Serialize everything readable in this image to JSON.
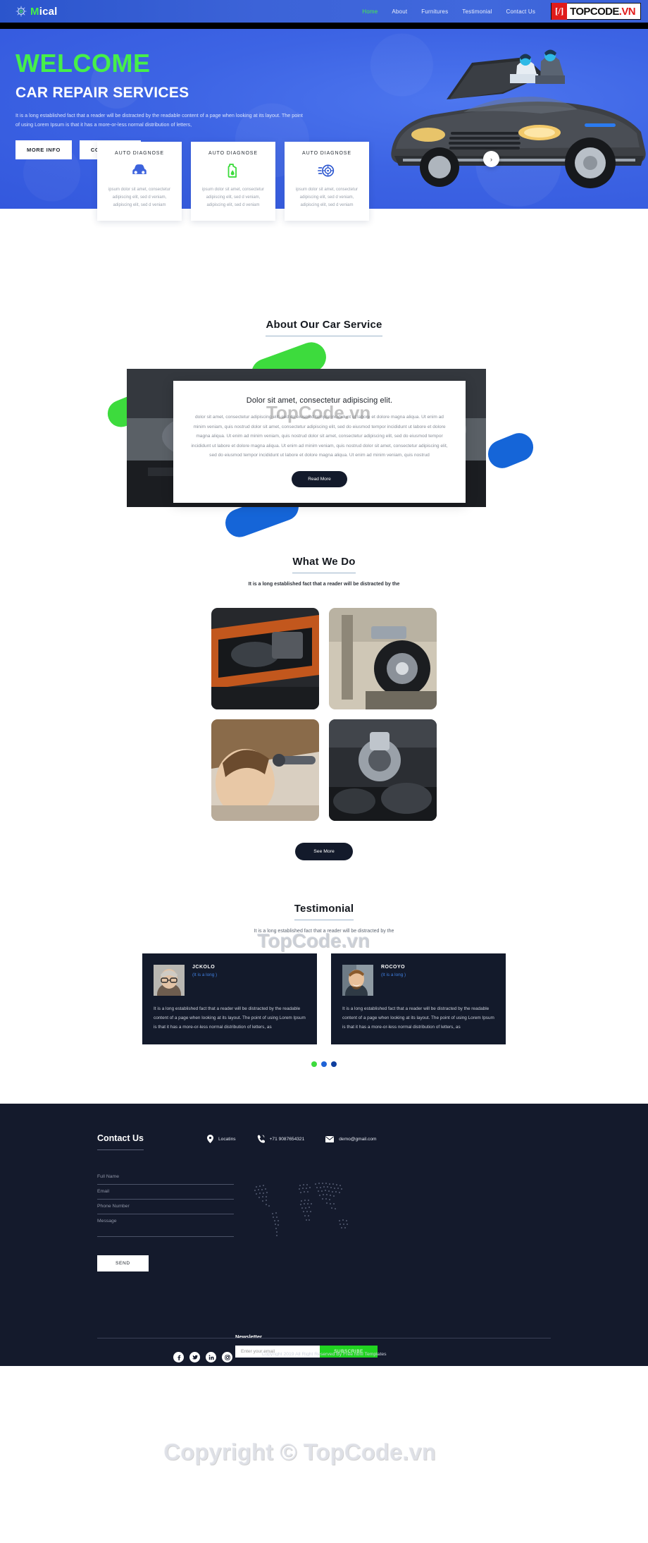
{
  "header": {
    "logo_text_green": "M",
    "logo_text_white": "ical",
    "logo_icon": "gear-logo-icon",
    "nav": [
      {
        "label": "Home",
        "active": true
      },
      {
        "label": "About",
        "active": false
      },
      {
        "label": "Furnitures",
        "active": false
      },
      {
        "label": "Testimonial",
        "active": false
      },
      {
        "label": "Contact Us",
        "active": false
      }
    ],
    "badge": {
      "mark": "[/]",
      "word_black": "TOPCODE",
      "word_red": ".VN"
    }
  },
  "hero": {
    "eyebrow": "WELCOME",
    "title": "CAR REPAIR SERVICES",
    "description": "It is a long established fact that a reader will be distracted by the readable content of a page when looking at its layout. The point of using Lorem Ipsum is that it has a more-or-less normal distribution of letters,",
    "buttons": [
      {
        "label": "MORE INFO"
      },
      {
        "label": "CONTACT US"
      }
    ],
    "next_arrow": "›"
  },
  "service_cards": [
    {
      "title": "AUTO DIAGNOSE",
      "icon": "car-icon",
      "icon_color": "#3d63dd",
      "description": "ipsum dolor sit amet, consectetur adipiscing elit, sed d veniam, adipiscing elit, sed d veniam"
    },
    {
      "title": "AUTO DIAGNOSE",
      "icon": "oil-can-icon",
      "icon_color": "#3ddb3d",
      "description": "ipsum dolor sit amet, consectetur adipiscing elit, sed d veniam, adipiscing elit, sed d veniam"
    },
    {
      "title": "AUTO DIAGNOSE",
      "icon": "brake-disc-icon",
      "icon_color": "#2a55cf",
      "description": "ipsum dolor sit amet, consectetur adipiscing elit, sed d veniam, adipiscing elit, sed d veniam"
    }
  ],
  "about": {
    "heading": "About Our Car Service",
    "card_title": "Dolor sit amet, consectetur adipiscing elit.",
    "card_body": "dolor sit amet, consectetur adipiscing elit, sed do eiusmod tempor incididunt ut labore et dolore magna aliqua. Ut enim ad minim veniam, quis nostrud dolor sit amet, consectetur adipiscing elit, sed do eiusmod tempor incididunt ut labore et dolore magna aliqua. Ut enim ad minim veniam, quis nostrud dolor sit amet, consectetur adipiscing elit, sed do eiusmod tempor incididunt ut labore et dolore magna aliqua. Ut enim ad minim veniam, quis nostrud dolor sit amet, consectetur adipiscing elit, sed do eiusmod tempor incididunt ut labore et dolore magna aliqua. Ut enim ad minim veniam, quis nostrud",
    "read_more": "Read More"
  },
  "what_we_do": {
    "heading": "What We Do",
    "subheading": "It is a long established fact that a reader will be distracted by the",
    "gallery": [
      {
        "name": "car-engine-bay-photo"
      },
      {
        "name": "wheel-alignment-photo"
      },
      {
        "name": "mechanic-woman-photo"
      },
      {
        "name": "engine-parts-photo"
      }
    ],
    "see_more": "See More"
  },
  "testimonial": {
    "heading": "Testimonial",
    "subheading": "It is a long established fact that a reader will be distracted by the",
    "items": [
      {
        "name": "JCKOLO",
        "role": "(It is a long )",
        "quote": "It is a long established fact that a reader will be distracted by the readable content of a page when looking at its layout. The point of using Lorem Ipsum is that it has a more-or-less normal distribution of letters, as"
      },
      {
        "name": "ROCOYO",
        "role": "(It is a long )",
        "quote": "It is a long established fact that a reader will be distracted by the readable content of a page when looking at its layout. The point of using Lorem Ipsum is that it has a more-or-less normal distribution of letters, as"
      }
    ],
    "dots": 3
  },
  "footer": {
    "contact_heading": "Contact Us",
    "contact_info": [
      {
        "icon": "location-pin-icon",
        "text": "Locatins"
      },
      {
        "icon": "phone-icon",
        "text": "+71 9087654321"
      },
      {
        "icon": "envelope-icon",
        "text": "demo@gmail.com"
      }
    ],
    "form": {
      "full_name_placeholder": "Full Name",
      "email_placeholder": "Email",
      "phone_placeholder": "Phone Number",
      "message_placeholder": "Message",
      "send_label": "SEND"
    },
    "socials": [
      {
        "name": "facebook-icon",
        "glyph": "f"
      },
      {
        "name": "twitter-icon",
        "glyph": "t"
      },
      {
        "name": "linkedin-icon",
        "glyph": "in"
      },
      {
        "name": "instagram-icon",
        "glyph": "ig"
      }
    ],
    "newsletter": {
      "heading": "Newsletter",
      "placeholder": "Enter your email",
      "button": "SUBSCRIBE"
    },
    "copyright": "Copyright 2019 All Right Reserved By Free html Templates"
  },
  "watermarks": {
    "a": "TopCode.vn",
    "b": "TopCode.vn",
    "c": "Copyright © TopCode.vn"
  },
  "colors": {
    "brand_blue": "#3d63dd",
    "accent_green": "#46ef4a",
    "dark_navy": "#141a2c",
    "subscribe_green": "#21d421"
  }
}
